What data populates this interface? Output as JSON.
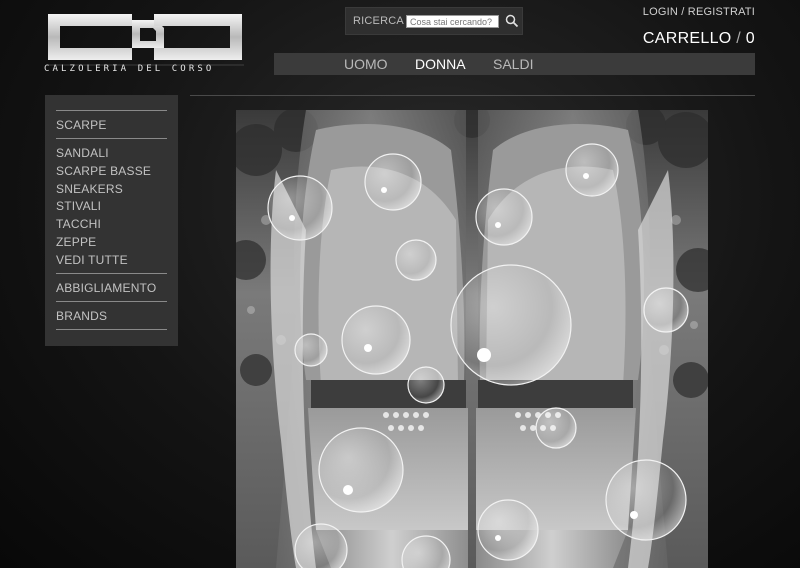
{
  "header": {
    "logo_text": "CALZOLERIA DEL CORSO",
    "logo_mark": "CDC",
    "login_label": "LOGIN",
    "register_label": "REGISTRATI",
    "login_sep": "/",
    "cart_label": "CARRELLO",
    "cart_sep": "/",
    "cart_count": "0"
  },
  "search": {
    "label": "RICERCA",
    "placeholder": "Cosa stai cercando?",
    "icon": "search-icon"
  },
  "nav": {
    "items": [
      {
        "label": "UOMO",
        "active": false
      },
      {
        "label": "DONNA",
        "active": true
      },
      {
        "label": "SALDI",
        "active": false
      }
    ]
  },
  "sidebar": {
    "category": "SCARPE",
    "items": [
      "SANDALI",
      "SCARPE BASSE",
      "SNEAKERS",
      "STIVALI",
      "TACCHI",
      "ZEPPE",
      "VEDI TUTTE"
    ],
    "sections": [
      "ABBIGLIAMENTO",
      "BRANDS"
    ]
  },
  "colors": {
    "background": "#111111",
    "sidebar_bg": "#333333",
    "navbar_bg": "#3b3b3b",
    "active_text": "#ffffff",
    "inactive_text": "#b9b9b9"
  }
}
